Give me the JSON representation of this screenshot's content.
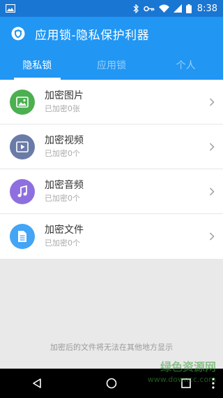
{
  "status_bar": {
    "time": "8:38",
    "icons": [
      "image-icon",
      "bluetooth-icon",
      "key-icon",
      "wifi-icon",
      "signal-icon",
      "battery-icon"
    ]
  },
  "app_bar": {
    "title": "应用锁-隐私保护利器",
    "logo_icon": "shield-icon"
  },
  "tabs": [
    {
      "label": "隐私锁",
      "active": true
    },
    {
      "label": "应用锁",
      "active": false
    },
    {
      "label": "个人",
      "active": false
    }
  ],
  "items": [
    {
      "title": "加密图片",
      "subtitle": "已加密0张",
      "icon": "image-icon",
      "color": "#4caf50"
    },
    {
      "title": "加密视频",
      "subtitle": "已加密0个",
      "icon": "video-icon",
      "color": "#6b7ba8"
    },
    {
      "title": "加密音频",
      "subtitle": "已加密0个",
      "icon": "music-icon",
      "color": "#8e6fe0"
    },
    {
      "title": "加密文件",
      "subtitle": "已加密0个",
      "icon": "document-icon",
      "color": "#42a5f5"
    }
  ],
  "footer_note": "加密后的文件将无法在其他地方显示",
  "watermark": {
    "line1": "绿色资源网",
    "line2": "www.downcc.com"
  },
  "colors": {
    "primary": "#2196f3",
    "status_bar": "#1976d2",
    "background": "#e9e9e9"
  }
}
